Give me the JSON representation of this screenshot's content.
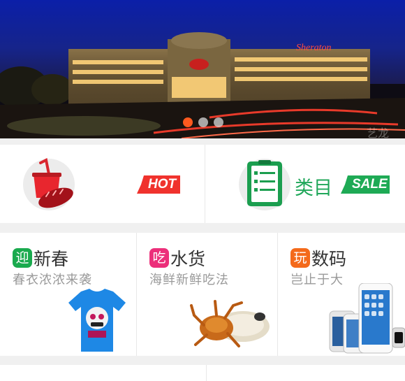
{
  "banner": {
    "image": "hotel-night-photo",
    "sign_text": "Sheraton",
    "watermark": "艺龙",
    "slides": 3,
    "active_slide": 1
  },
  "promo_row": {
    "left": {
      "icon": "cup-bread-icon",
      "tag": "HOT"
    },
    "right": {
      "icon": "list-clipboard-icon",
      "label": "类目",
      "tag": "SALE"
    }
  },
  "cards": [
    {
      "badge": "迎",
      "title": "新春",
      "subtitle": "春衣浓浓来袭",
      "image": "blue-tshirt-image",
      "badge_color": "#1aaa4e"
    },
    {
      "badge": "吃",
      "title": "水货",
      "subtitle": "海鲜新鲜吃法",
      "image": "crab-image",
      "badge_color": "#ec2f7a"
    },
    {
      "badge": "玩",
      "title": "数码",
      "subtitle": "岂止于大",
      "image": "smartphones-image",
      "badge_color": "#f46a1b"
    }
  ],
  "colors": {
    "hot": "#f0322d",
    "sale": "#1eaa55",
    "dot_active": "#ff5a1f"
  }
}
